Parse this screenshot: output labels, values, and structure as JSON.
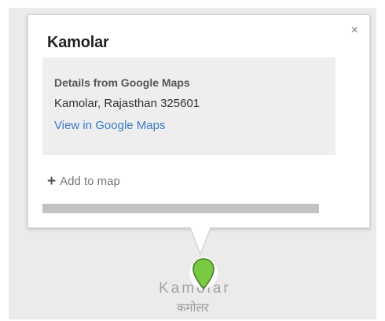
{
  "popup": {
    "title": "Kamolar",
    "close_icon": "×",
    "details": {
      "heading": "Details from Google Maps",
      "address": "Kamolar, Rajasthan 325601",
      "link_text": "View in Google Maps"
    },
    "add_icon": "+",
    "add_to_map": "Add to map"
  },
  "map": {
    "place_label": "Kamolar",
    "place_label_local": "कमोलर",
    "marker_color": "#7ac943"
  }
}
